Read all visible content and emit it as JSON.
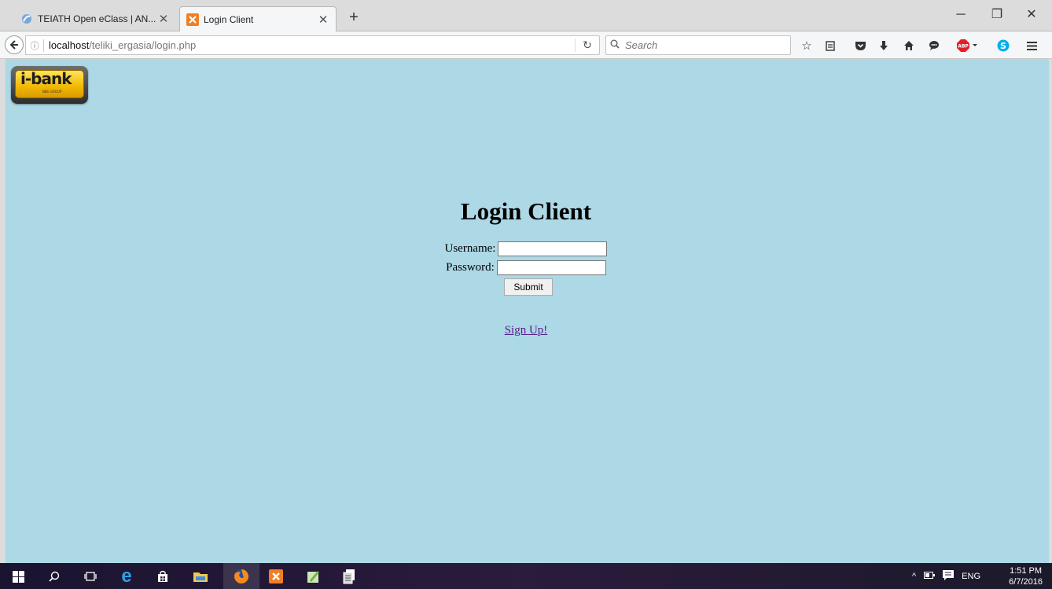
{
  "tabs": [
    {
      "title": "TEIATH Open eClass | AN...",
      "favicon": "eclass-icon",
      "active": false
    },
    {
      "title": "Login Client",
      "favicon": "xampp-icon",
      "active": true
    }
  ],
  "url": {
    "host": "localhost",
    "path": "/teliki_ergasia/login.php"
  },
  "search": {
    "placeholder": "Search"
  },
  "toolbar_icons": [
    "bookmark-star-icon",
    "reading-list-icon",
    "pocket-icon",
    "download-icon",
    "home-icon",
    "chat-icon",
    "adblock-icon",
    "skype-icon",
    "menu-icon"
  ],
  "page": {
    "logo": {
      "text": "i-bank",
      "subtext": "NBG GROUP"
    },
    "title": "Login Client",
    "form": {
      "username_label": "Username:",
      "username_value": "",
      "password_label": "Password:",
      "password_value": "",
      "submit_label": "Submit"
    },
    "signup_link": "Sign Up!"
  },
  "colors": {
    "page_background": "#add8e6",
    "link_visited": "#551a8b"
  },
  "taskbar": {
    "tray_language": "ENG",
    "clock_time": "1:51 PM",
    "clock_date": "6/7/2016"
  }
}
